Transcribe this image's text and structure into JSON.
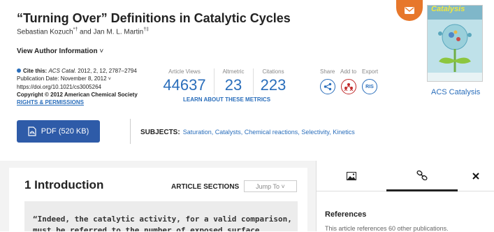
{
  "article": {
    "title": "“Turning Over” Definitions in Catalytic Cycles",
    "authors": [
      {
        "name": "Sebastian Kozuch",
        "marks": "*†"
      },
      {
        "name": "Jan M. L. Martin",
        "marks": "†‡"
      }
    ],
    "authors_joiner": " and ",
    "view_author_info": "View Author Information",
    "chevron": "˅"
  },
  "citation": {
    "cite_label": "Cite this:",
    "journal": "ACS Catal.",
    "details": " 2012, 2, 12, 2787–2794",
    "publication_date": "Publication Date: November 8, 2012",
    "doi": "https://doi.org/10.1021/cs3005264",
    "copyright": "Copyright © 2012 American Chemical Society",
    "rights": "RIGHTS & PERMISSIONS"
  },
  "metrics": {
    "items": [
      {
        "label": "Article Views",
        "value": "44637"
      },
      {
        "label": "Altmetric",
        "value": "23"
      },
      {
        "label": "Citations",
        "value": "223"
      }
    ],
    "learn_more": "LEARN ABOUT THESE METRICS"
  },
  "share": {
    "share_label": "Share",
    "add_label": "Add to",
    "export_label": "Export",
    "export_button": "RIS"
  },
  "journal": {
    "cover_title": "Catalysis",
    "link_label": "ACS Catalysis",
    "accent": "#e7772b"
  },
  "actions": {
    "pdf_label": "PDF (520 KB)"
  },
  "subjects": {
    "label": "SUBJECTS:",
    "items": [
      "Saturation",
      "Catalysts",
      "Chemical reactions",
      "Selectivity",
      "Kinetics"
    ],
    "separator": ", "
  },
  "content": {
    "section_heading": "1 Introduction",
    "article_sections_label": "ARTICLE SECTIONS",
    "jump_to": "Jump To",
    "jump_chevron": "˅",
    "quote_line1": "“Indeed, the catalytic activity, for a valid comparison,",
    "quote_line2": "must be referred to the number of exposed surface"
  },
  "side_panel": {
    "tabs": [
      {
        "icon": "image-icon",
        "active": false
      },
      {
        "icon": "link-icon",
        "active": true
      },
      {
        "icon": "close-icon",
        "active": false
      }
    ],
    "references_title": "References",
    "references_text": "This article references 60 other publications."
  },
  "colors": {
    "link_blue": "#2a6ebb",
    "pdf_button": "#2e5ba8",
    "add_red": "#c12a2a"
  }
}
